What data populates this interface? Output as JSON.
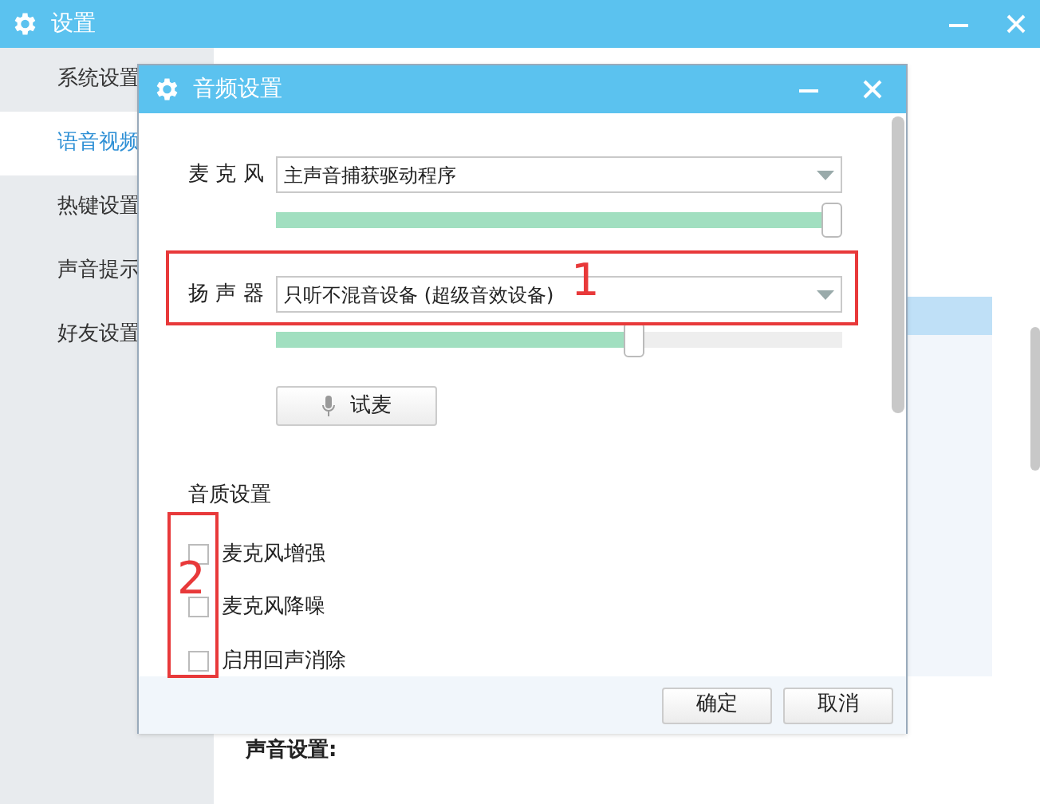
{
  "window": {
    "title": "设置"
  },
  "sidebar": {
    "items": [
      {
        "label": "系统设置",
        "selected": false
      },
      {
        "label": "语音视频",
        "selected": true
      },
      {
        "label": "热键设置",
        "selected": false
      },
      {
        "label": "声音提示",
        "selected": false
      },
      {
        "label": "好友设置",
        "selected": false
      }
    ]
  },
  "content": {
    "section_heading": "声音设置:"
  },
  "dialog": {
    "title": "音频设置",
    "devices": [
      {
        "label": "麦 克 风",
        "value": "主声音捕获驱动程序",
        "level": 1
      },
      {
        "label": "扬 声 器",
        "value": "只听不混音设备 (超级音效设备)",
        "level": 0.65
      }
    ],
    "test_button": "试麦",
    "quality_heading": "音质设置",
    "options": [
      {
        "label": "麦克风增强",
        "checked": false
      },
      {
        "label": "麦克风降噪",
        "checked": false
      },
      {
        "label": "启用回声消除",
        "checked": false
      }
    ],
    "buttons": [
      "确定",
      "取消"
    ]
  },
  "annotations": [
    {
      "label": "1"
    },
    {
      "label": "2"
    }
  ]
}
